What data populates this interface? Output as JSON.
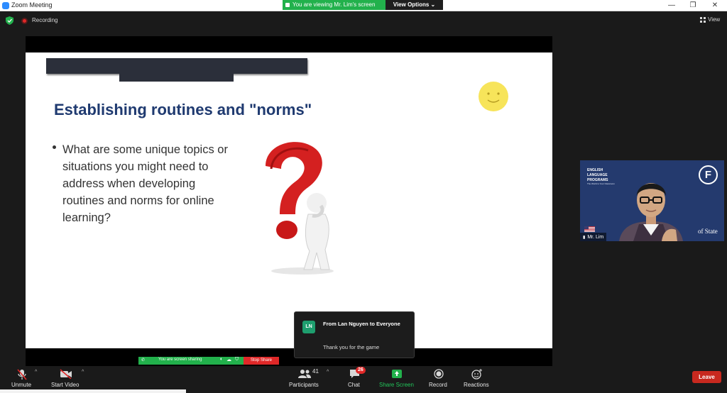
{
  "window": {
    "title": "Zoom Meeting",
    "minimize": "—",
    "maximize": "❐",
    "close": "✕"
  },
  "share_banner": {
    "viewing_text": "You are viewing Mr. Lim's screen",
    "view_options": "View Options"
  },
  "topbar": {
    "recording_label": "Recording",
    "view_label": "View"
  },
  "slide": {
    "title": "Establishing routines and \"norms\"",
    "bullet": "What are some unique topics or situations you might need to address when developing routines and norms for online learning?"
  },
  "speaker": {
    "name": "Mr. Lim",
    "logo_text": "ENGLISH LANGUAGE PROGRAMS",
    "logo_sub": "The World is Your Classroom",
    "badge_letter": "F",
    "state_text": "of State"
  },
  "sharing_bar": {
    "text": "You are screen sharing",
    "stop_label": "Stop Share"
  },
  "chat_toast": {
    "initials": "LN",
    "from": "From Lan Nguyen to Everyone",
    "message": "Thank you for the game"
  },
  "toolbar": {
    "unmute": "Unmute",
    "start_video": "Start Video",
    "participants": "Participants",
    "participant_count": "41",
    "chat": "Chat",
    "chat_badge": "26",
    "share_screen": "Share Screen",
    "record": "Record",
    "reactions": "Reactions",
    "leave": "Leave"
  },
  "colors": {
    "share_green": "#22b14c",
    "leave_red": "#c8291f",
    "title_blue": "#1f3a70",
    "speaker_bg": "#243a6e"
  }
}
